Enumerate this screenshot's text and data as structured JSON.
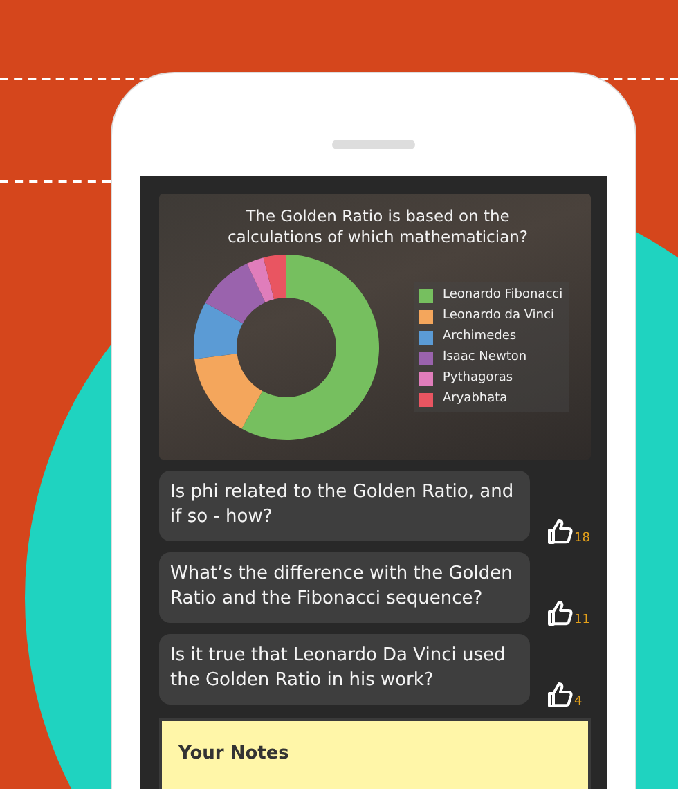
{
  "poll": {
    "question": "The Golden Ratio is based on the calculations of which mathematician?",
    "legend": [
      {
        "label": "Leonardo Fibonacci",
        "color": "#76bf5f"
      },
      {
        "label": "Leonardo da Vinci",
        "color": "#f4a65c"
      },
      {
        "label": "Archimedes",
        "color": "#5b9bd5"
      },
      {
        "label": "Isaac Newton",
        "color": "#9a63ad"
      },
      {
        "label": "Pythagoras",
        "color": "#e07dbb"
      },
      {
        "label": "Aryabhata",
        "color": "#e95561"
      }
    ]
  },
  "questions": [
    {
      "text": "Is phi related to the Golden Ratio, and if so - how?",
      "likes": "18"
    },
    {
      "text": "What’s the difference with the Golden Ratio and the Fibonacci sequence?",
      "likes": "11"
    },
    {
      "text": "Is it true that Leonardo Da Vinci used the Golden Ratio in his work?",
      "likes": "4"
    }
  ],
  "notes": {
    "title": "Your Notes"
  }
}
